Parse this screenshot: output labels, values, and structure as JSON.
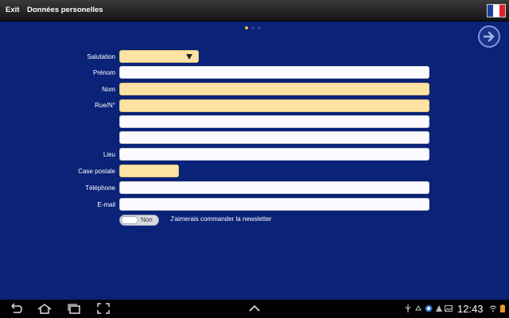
{
  "topbar": {
    "exit_label": "Exit",
    "title": "Données personelles",
    "flag_icon": "france-flag-icon"
  },
  "pager": {
    "count": 3,
    "active": 0
  },
  "next_icon": "arrow-right-circle-icon",
  "form": {
    "salutation_label": "Salutation",
    "salutation_value": "",
    "prenom_label": "Prénom",
    "nom_label": "Nom",
    "rue_label": "Rue/N°",
    "lieu_label": "Lieu",
    "case_postale_label": "Case postale",
    "telephone_label": "Téléphone",
    "email_label": "E-mail"
  },
  "newsletter": {
    "toggle_text": "Non",
    "label": "J'aimerais commander la newsletter"
  },
  "statusbar": {
    "time": "12:43"
  },
  "colors": {
    "background": "#0a2277",
    "required_field": "#fde3a3",
    "accent_dot": "#f2b93b"
  }
}
